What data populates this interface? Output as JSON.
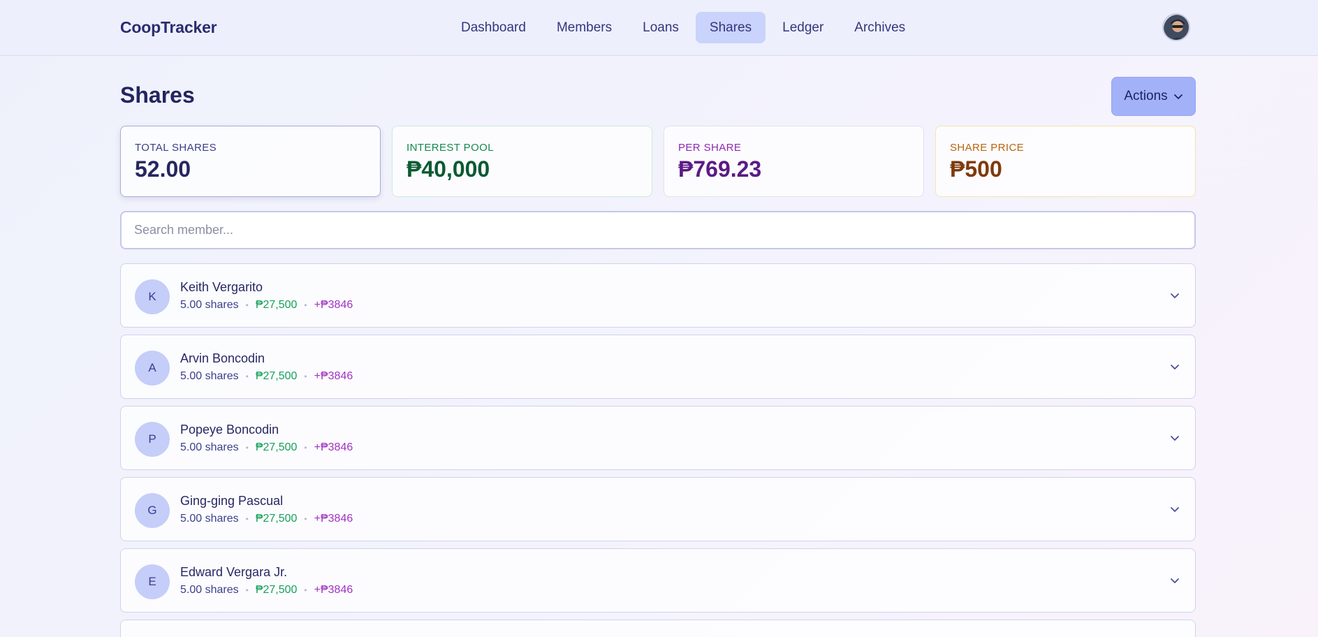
{
  "app": {
    "brand": "CoopTracker"
  },
  "nav": {
    "items": [
      {
        "label": "Dashboard",
        "active": false
      },
      {
        "label": "Members",
        "active": false
      },
      {
        "label": "Loans",
        "active": false
      },
      {
        "label": "Shares",
        "active": true
      },
      {
        "label": "Ledger",
        "active": false
      },
      {
        "label": "Archives",
        "active": false
      }
    ]
  },
  "page": {
    "title": "Shares",
    "actions_label": "Actions"
  },
  "stats": {
    "total_shares": {
      "label": "Total Shares",
      "value": "52.00"
    },
    "interest_pool": {
      "label": "Interest Pool",
      "value": "₱40,000"
    },
    "per_share": {
      "label": "Per Share",
      "value": "₱769.23"
    },
    "share_price": {
      "label": "Share Price",
      "value": "₱500"
    }
  },
  "search": {
    "placeholder": "Search member...",
    "value": ""
  },
  "members": [
    {
      "initial": "K",
      "name": "Keith Vergarito",
      "shares": "5.00 shares",
      "amount": "₱27,500",
      "interest": "+₱3846"
    },
    {
      "initial": "A",
      "name": "Arvin Boncodin",
      "shares": "5.00 shares",
      "amount": "₱27,500",
      "interest": "+₱3846"
    },
    {
      "initial": "P",
      "name": "Popeye Boncodin",
      "shares": "5.00 shares",
      "amount": "₱27,500",
      "interest": "+₱3846"
    },
    {
      "initial": "G",
      "name": "Ging-ging Pascual",
      "shares": "5.00 shares",
      "amount": "₱27,500",
      "interest": "+₱3846"
    },
    {
      "initial": "E",
      "name": "Edward Vergara Jr.",
      "shares": "5.00 shares",
      "amount": "₱27,500",
      "interest": "+₱3846"
    }
  ],
  "colors": {
    "accent": "#a3b1f9",
    "nav_active": "#c9d3fb",
    "positive": "#16a05a",
    "interest": "#a133c2",
    "price": "#b9660d"
  }
}
